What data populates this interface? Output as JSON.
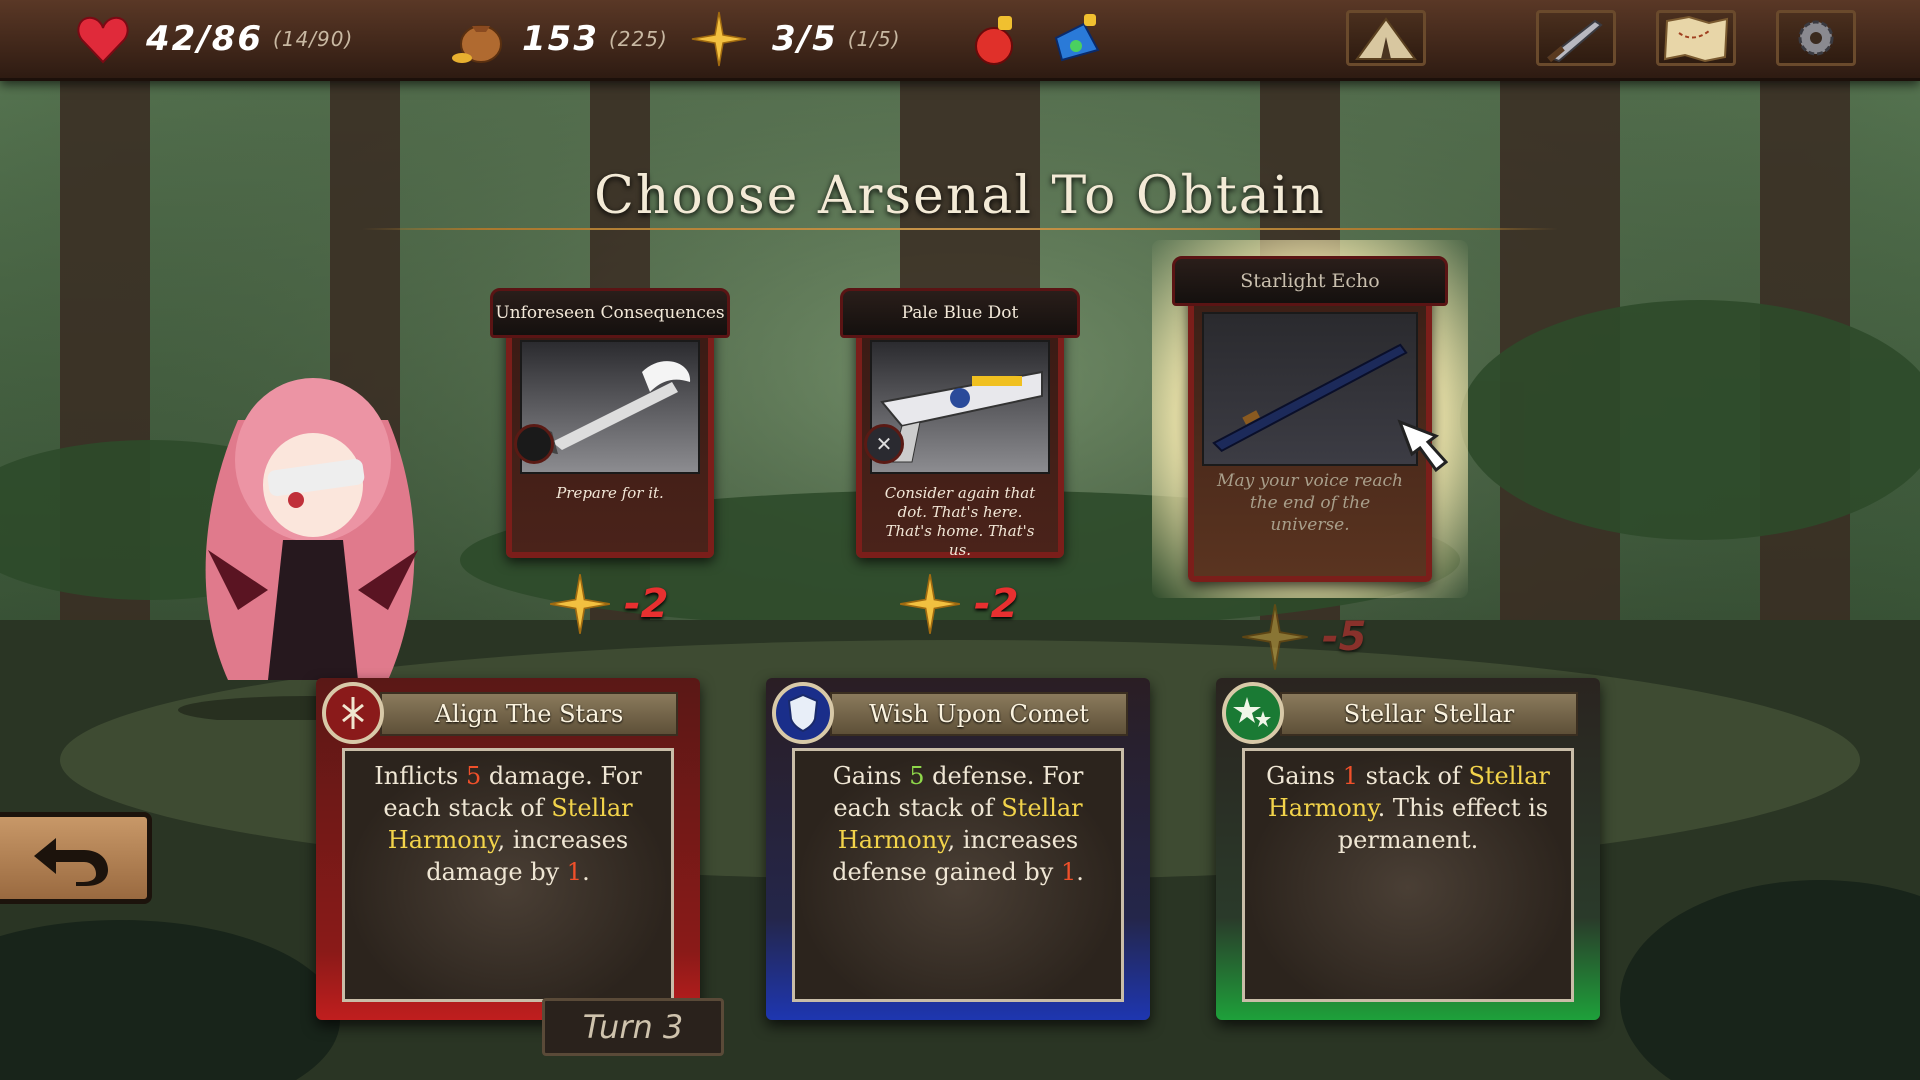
{
  "topbar": {
    "hp": {
      "main": "42/86",
      "sub": "(14/90)"
    },
    "gold": {
      "main": "153",
      "sub": "(225)"
    },
    "stars": {
      "main": "3/5",
      "sub": "(1/5)"
    },
    "icons": [
      "heart-icon",
      "coin-bag-icon",
      "star-icon",
      "red-potion-icon",
      "blue-potion-icon",
      "camp-tent-icon",
      "sword-icon",
      "map-icon",
      "settings-gear-icon"
    ]
  },
  "title": "Choose Arsenal To Obtain",
  "arsenal": [
    {
      "name": "Unforeseen Consequences",
      "desc": "Prepare for it.",
      "cost": "-2"
    },
    {
      "name": "Pale Blue Dot",
      "desc": "Consider again that dot. That's here. That's home. That's us.",
      "cost": "-2"
    },
    {
      "name": "Starlight Echo",
      "desc": "May your voice reach the end of the universe.",
      "cost": "-5"
    }
  ],
  "skills": [
    {
      "name": "Align The Stars",
      "color": "#b01e1e",
      "parts": [
        "Inflicts ",
        "5",
        " damage. For each stack of ",
        "Stellar Harmony",
        ", increases damage by ",
        "1",
        "."
      ]
    },
    {
      "name": "Wish Upon Comet",
      "color": "#1e3aa8",
      "parts": [
        "Gains ",
        "5",
        " defense. For each stack of ",
        "Stellar Harmony",
        ", increases defense gained by ",
        "1",
        "."
      ]
    },
    {
      "name": "Stellar Stellar",
      "color": "#1e9a3a",
      "parts": [
        "Gains ",
        "1",
        " stack of ",
        "Stellar Harmony",
        ". This effect is permanent."
      ]
    }
  ],
  "turn_label": "Turn 3",
  "colors": {
    "accent": "#c8954a",
    "cost_red": "#e83030",
    "keyword_yellow": "#f2d34a"
  }
}
